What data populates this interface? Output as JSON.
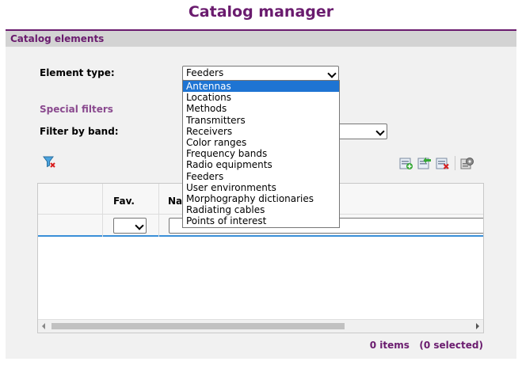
{
  "title": "Catalog manager",
  "panel": {
    "header": "Catalog elements"
  },
  "element_type": {
    "label": "Element type:",
    "selected": "Feeders",
    "options": [
      "Antennas",
      "Locations",
      "Methods",
      "Transmitters",
      "Receivers",
      "Color ranges",
      "Frequency bands",
      "Radio equipments",
      "Feeders",
      "User environments",
      "Morphography dictionaries",
      "Radiating cables",
      "Points of interest"
    ],
    "highlighted": "Antennas"
  },
  "special_filters": {
    "label": "Special filters"
  },
  "filter_band": {
    "label": "Filter by band:",
    "selected": ""
  },
  "grid": {
    "columns": [
      "Fav.",
      "Na"
    ],
    "fav_filter": ""
  },
  "status": {
    "text": "0 items   (0 selected)"
  },
  "icons": [
    "clear-filter-icon",
    "add-element-icon",
    "import-element-icon",
    "delete-element-icon",
    "settings-icon"
  ]
}
